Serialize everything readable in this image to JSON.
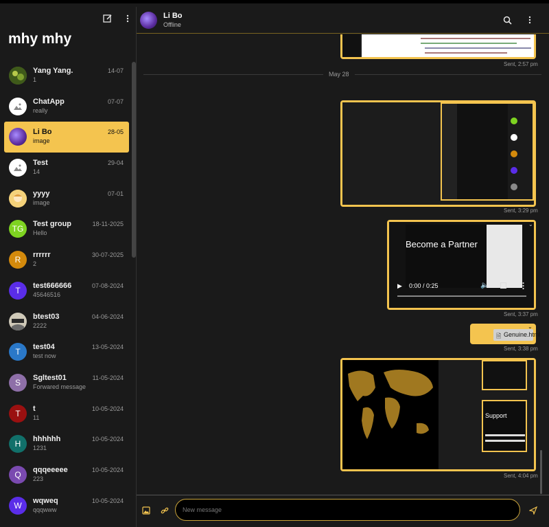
{
  "sidebar": {
    "title": "mhy mhy",
    "chats": [
      {
        "name": "Yang Yang.",
        "preview": "1",
        "date": "14-07",
        "avatar_color": "#5c7a2a",
        "avatar_letter": ""
      },
      {
        "name": "ChatApp",
        "preview": "really",
        "date": "07-07",
        "avatar_color": "#ffffff",
        "avatar_letter": ""
      },
      {
        "name": "Li Bo",
        "preview": "image",
        "date": "28-05",
        "avatar_color": "#6b3fb3",
        "avatar_letter": ""
      },
      {
        "name": "Test",
        "preview": "14",
        "date": "29-04",
        "avatar_color": "#ffffff",
        "avatar_letter": ""
      },
      {
        "name": "yyyy",
        "preview": "image",
        "date": "07-01",
        "avatar_color": "#f0c060",
        "avatar_letter": ""
      },
      {
        "name": "Test group",
        "preview": "Hello",
        "date": "18-11-2025",
        "avatar_color": "#7ed321",
        "avatar_letter": "TG"
      },
      {
        "name": "rrrrrr",
        "preview": "2",
        "date": "30-07-2025",
        "avatar_color": "#d48a0c",
        "avatar_letter": "R"
      },
      {
        "name": "test666666",
        "preview": "45646516",
        "date": "07-08-2024",
        "avatar_color": "#5a2de8",
        "avatar_letter": "T"
      },
      {
        "name": "btest03",
        "preview": "2222",
        "date": "04-06-2024",
        "avatar_color": "#8a8a8a",
        "avatar_letter": ""
      },
      {
        "name": "test04",
        "preview": "test now",
        "date": "13-05-2024",
        "avatar_color": "#2a78c8",
        "avatar_letter": "T"
      },
      {
        "name": "Sgltest01",
        "preview": "Forwared message",
        "date": "11-05-2024",
        "avatar_color": "#8e6fa8",
        "avatar_letter": "S"
      },
      {
        "name": "t",
        "preview": "11",
        "date": "10-05-2024",
        "avatar_color": "#9a1010",
        "avatar_letter": "T"
      },
      {
        "name": "hhhhhh",
        "preview": "1231",
        "date": "10-05-2024",
        "avatar_color": "#11706a",
        "avatar_letter": "H"
      },
      {
        "name": "qqqeeeee",
        "preview": "223",
        "date": "10-05-2024",
        "avatar_color": "#7a4ab0",
        "avatar_letter": "Q"
      },
      {
        "name": "wqweq",
        "preview": "qqqwww",
        "date": "10-05-2024",
        "avatar_color": "#5a2de8",
        "avatar_letter": "W"
      }
    ]
  },
  "header": {
    "name": "Li Bo",
    "status": "Offline"
  },
  "messages": {
    "stamps": [
      "Sent, 2:57 pm",
      "Sent, 3:29 pm",
      "Sent, 3:37 pm",
      "Sent, 3:38 pm",
      "Sent, 4:04 pm"
    ],
    "date_divider": "May 28",
    "video_overlay_text": "Become a Partner",
    "video_time": "0:00 / 0:25",
    "file_name": "Genuine.html",
    "thumb_text": "Support"
  },
  "composer": {
    "placeholder": "New message"
  },
  "colors": {
    "accent": "#f4c44f",
    "background": "#1a1a1a"
  }
}
